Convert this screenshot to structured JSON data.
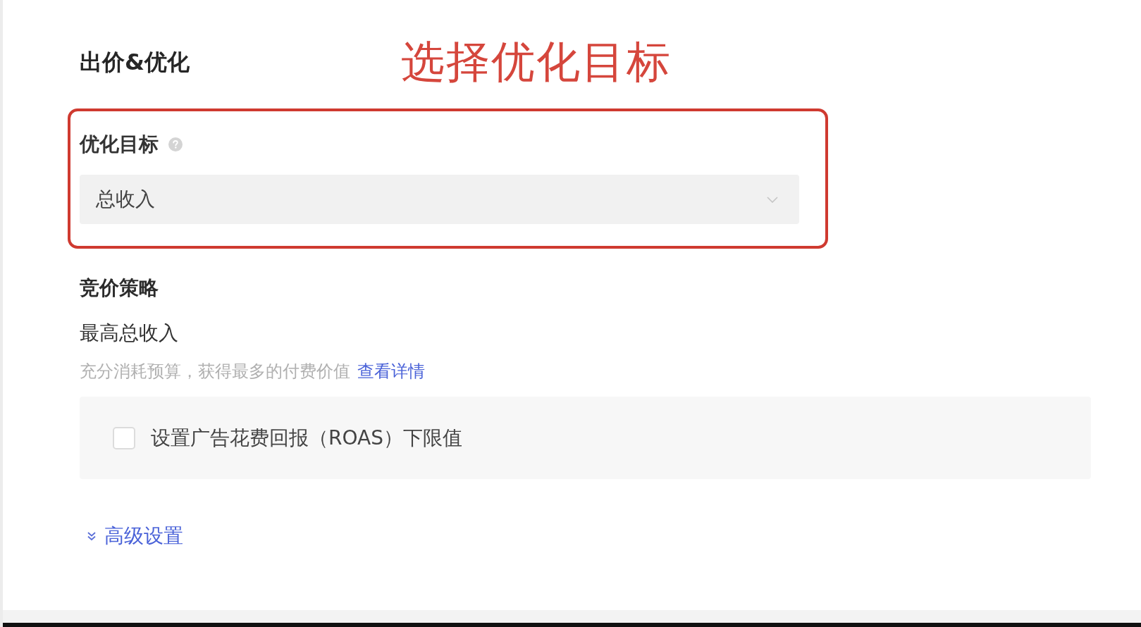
{
  "header": {
    "title": "出价&优化",
    "annotation": "选择优化目标"
  },
  "optimization_goal": {
    "label": "优化目标",
    "value": "总收入",
    "highlighted": true
  },
  "bid_strategy": {
    "title": "竞价策略",
    "option": "最高总收入",
    "description": "充分消耗预算，获得最多的付费价值",
    "link": "查看详情"
  },
  "roas_option": {
    "label": "设置广告花费回报（ROAS）下限值",
    "checked": false
  },
  "advanced_settings": {
    "label": "高级设置",
    "expanded": false
  }
}
